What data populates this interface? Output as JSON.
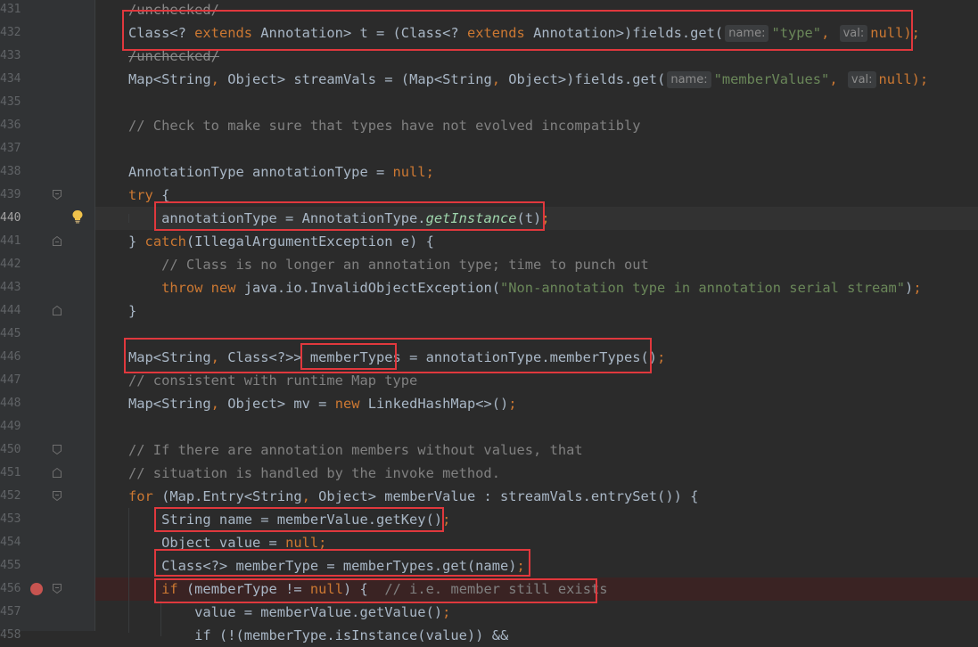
{
  "editor": {
    "lines": [
      {
        "num": "431",
        "segs": [
          {
            "t": "/unchecked/",
            "c": "strike"
          }
        ]
      },
      {
        "num": "432",
        "segs": [
          {
            "t": "Class<? ",
            "c": ""
          },
          {
            "t": "extends",
            "c": "kw"
          },
          {
            "t": " Annotation> t = (Class<? ",
            "c": ""
          },
          {
            "t": "extends",
            "c": "kw"
          },
          {
            "t": " Annotation>)fields.get(",
            "c": ""
          },
          {
            "t": "name:",
            "c": "hint"
          },
          {
            "t": "\"type\"",
            "c": "str"
          },
          {
            "t": ", ",
            "c": "kw"
          },
          {
            "t": "val:",
            "c": "hint"
          },
          {
            "t": "null",
            "c": "kw"
          },
          {
            "t": ");",
            "c": "kw"
          }
        ]
      },
      {
        "num": "433",
        "segs": [
          {
            "t": "/unchecked/",
            "c": "strike"
          }
        ]
      },
      {
        "num": "434",
        "segs": [
          {
            "t": "Map<String",
            "c": ""
          },
          {
            "t": ", ",
            "c": "kw"
          },
          {
            "t": "Object> streamVals = (Map<String",
            "c": ""
          },
          {
            "t": ", ",
            "c": "kw"
          },
          {
            "t": "Object>)fields.get(",
            "c": ""
          },
          {
            "t": "name:",
            "c": "hint"
          },
          {
            "t": "\"memberValues\"",
            "c": "str"
          },
          {
            "t": ", ",
            "c": "kw"
          },
          {
            "t": "val:",
            "c": "hint"
          },
          {
            "t": "null",
            "c": "kw"
          },
          {
            "t": ");",
            "c": "kw"
          }
        ]
      },
      {
        "num": "435",
        "segs": []
      },
      {
        "num": "436",
        "segs": [
          {
            "t": "// Check to make sure that types have not evolved incompatibly",
            "c": "cm"
          }
        ]
      },
      {
        "num": "437",
        "segs": []
      },
      {
        "num": "438",
        "segs": [
          {
            "t": "AnnotationType annotationType = ",
            "c": ""
          },
          {
            "t": "null;",
            "c": "kw"
          }
        ]
      },
      {
        "num": "439",
        "segs": [
          {
            "t": "try",
            "c": "kw"
          },
          {
            "t": " {",
            "c": ""
          }
        ]
      },
      {
        "num": "440",
        "segs": [
          {
            "t": "    annotationType = AnnotationType.",
            "c": ""
          },
          {
            "t": "getInstance",
            "c": "fn-it"
          },
          {
            "t": "(t)",
            "c": ""
          },
          {
            "t": ";",
            "c": "kw"
          }
        ]
      },
      {
        "num": "441",
        "segs": [
          {
            "t": "} ",
            "c": ""
          },
          {
            "t": "catch",
            "c": "kw"
          },
          {
            "t": "(IllegalArgumentException e) {",
            "c": ""
          }
        ]
      },
      {
        "num": "442",
        "segs": [
          {
            "t": "    // Class is no longer an annotation type; time to punch out",
            "c": "cm"
          }
        ]
      },
      {
        "num": "443",
        "segs": [
          {
            "t": "    ",
            "c": ""
          },
          {
            "t": "throw new",
            "c": "kw"
          },
          {
            "t": " java.io.InvalidObjectException(",
            "c": ""
          },
          {
            "t": "\"Non-annotation type in annotation serial stream\"",
            "c": "str"
          },
          {
            "t": ")",
            "c": ""
          },
          {
            "t": ";",
            "c": "kw"
          }
        ]
      },
      {
        "num": "444",
        "segs": [
          {
            "t": "}",
            "c": ""
          }
        ]
      },
      {
        "num": "445",
        "segs": []
      },
      {
        "num": "446",
        "segs": [
          {
            "t": "Map<String",
            "c": ""
          },
          {
            "t": ", ",
            "c": "kw"
          },
          {
            "t": "Class<?>> memberTypes = annotationType.memberTypes()",
            "c": ""
          },
          {
            "t": ";",
            "c": "kw"
          }
        ]
      },
      {
        "num": "447",
        "segs": [
          {
            "t": "// consistent with runtime Map type",
            "c": "cm"
          }
        ]
      },
      {
        "num": "448",
        "segs": [
          {
            "t": "Map<String",
            "c": ""
          },
          {
            "t": ", ",
            "c": "kw"
          },
          {
            "t": "Object> mv = ",
            "c": ""
          },
          {
            "t": "new",
            "c": "kw"
          },
          {
            "t": " LinkedHashMap<>()",
            "c": ""
          },
          {
            "t": ";",
            "c": "kw"
          }
        ]
      },
      {
        "num": "449",
        "segs": []
      },
      {
        "num": "450",
        "segs": [
          {
            "t": "// If there are annotation members without values, that",
            "c": "cm"
          }
        ]
      },
      {
        "num": "451",
        "segs": [
          {
            "t": "// situation is handled by the invoke method.",
            "c": "cm"
          }
        ]
      },
      {
        "num": "452",
        "segs": [
          {
            "t": "for",
            "c": "kw"
          },
          {
            "t": " (Map.Entry<String",
            "c": ""
          },
          {
            "t": ", ",
            "c": "kw"
          },
          {
            "t": "Object> memberValue : streamVals.entrySet()) {",
            "c": ""
          }
        ]
      },
      {
        "num": "453",
        "segs": [
          {
            "t": "    String name = memberValue.getKey()",
            "c": ""
          },
          {
            "t": ";",
            "c": "kw"
          }
        ]
      },
      {
        "num": "454",
        "segs": [
          {
            "t": "    Object value = ",
            "c": ""
          },
          {
            "t": "null;",
            "c": "kw"
          }
        ]
      },
      {
        "num": "455",
        "segs": [
          {
            "t": "    Class<?> memberType = memberTypes.get(name)",
            "c": ""
          },
          {
            "t": ";",
            "c": "kw"
          }
        ]
      },
      {
        "num": "456",
        "segs": [
          {
            "t": "    ",
            "c": ""
          },
          {
            "t": "if",
            "c": "kw"
          },
          {
            "t": " (memberType != ",
            "c": ""
          },
          {
            "t": "null",
            "c": "kw"
          },
          {
            "t": ") {  ",
            "c": ""
          },
          {
            "t": "// i.e. member still exists",
            "c": "cm"
          }
        ]
      },
      {
        "num": "457",
        "segs": [
          {
            "t": "        value = memberValue.getValue()",
            "c": ""
          },
          {
            "t": ";",
            "c": "kw"
          }
        ]
      },
      {
        "num": "458",
        "segs": [
          {
            "t": "        if (!(memberType.isInstance(value)) &&",
            "c": ""
          }
        ]
      }
    ],
    "colors": {
      "keyword": "#cc7832",
      "string": "#6a8759",
      "comment": "#808080",
      "highlight_box": "#e0383d"
    },
    "icons": [
      "fold-marker-icon",
      "lightbulb-icon",
      "breakpoint-icon"
    ]
  }
}
